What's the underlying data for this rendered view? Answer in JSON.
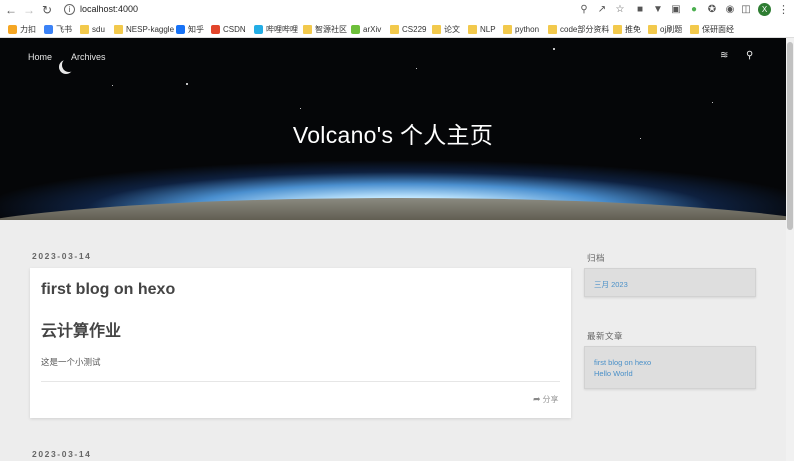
{
  "browser": {
    "url": "localhost:4000",
    "avatar_initial": "X",
    "bookmarks": [
      "力扣",
      "飞书",
      "sdu",
      "NESP-kaggle",
      "知乎",
      "CSDN",
      "哔哩哔哩",
      "智源社区",
      "arXiv",
      "CS229",
      "论文",
      "NLP",
      "python",
      "code部分资料",
      "推免",
      "oj刷题",
      "保研面经"
    ]
  },
  "site": {
    "title": "Volcano's 个人主页",
    "nav": [
      "Home",
      "Archives"
    ]
  },
  "posts": [
    {
      "date": "2023-03-14",
      "title": "first blog on hexo",
      "heading": "云计算作业",
      "text": "这是一个小测试",
      "share_label": "分享"
    },
    {
      "date": "2023-03-14"
    }
  ],
  "sidebar": {
    "archive_title": "归档",
    "archive_items": [
      "三月 2023"
    ],
    "recent_title": "最新文章",
    "recent_items": [
      "first blog on hexo",
      "Hello World"
    ]
  },
  "colors": {
    "link": "#4a90c8",
    "background": "#ededed"
  }
}
